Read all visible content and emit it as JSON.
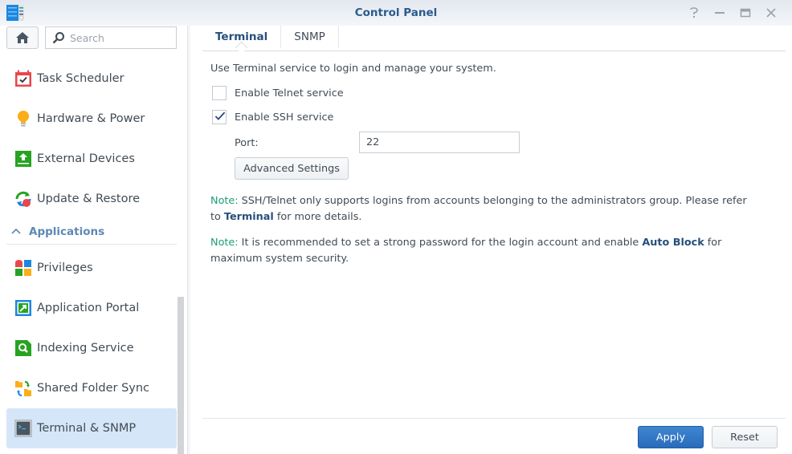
{
  "window": {
    "title": "Control Panel",
    "controls": [
      {
        "name": "help-icon",
        "glyph": "?"
      },
      {
        "name": "minimize-icon",
        "glyph": "—"
      },
      {
        "name": "maximize-icon",
        "glyph": "▭"
      },
      {
        "name": "close-icon",
        "glyph": "✕"
      }
    ]
  },
  "sidebar": {
    "search_placeholder": "Search",
    "items_top": [
      {
        "label": "Task Scheduler",
        "icon": "calendar-check-icon"
      },
      {
        "label": "Hardware & Power",
        "icon": "lightbulb-icon"
      },
      {
        "label": "External Devices",
        "icon": "upload-drive-icon"
      },
      {
        "label": "Update & Restore",
        "icon": "update-icon"
      }
    ],
    "section": {
      "label": "Applications",
      "expanded": true
    },
    "items_apps": [
      {
        "label": "Privileges",
        "icon": "privileges-icon"
      },
      {
        "label": "Application Portal",
        "icon": "portal-icon"
      },
      {
        "label": "Indexing Service",
        "icon": "indexing-icon"
      },
      {
        "label": "Shared Folder Sync",
        "icon": "folder-sync-icon"
      },
      {
        "label": "Terminal & SNMP",
        "icon": "terminal-icon",
        "selected": true
      }
    ]
  },
  "main": {
    "tabs": [
      {
        "label": "Terminal",
        "active": true
      },
      {
        "label": "SNMP",
        "active": false
      }
    ],
    "description": "Use Terminal service to login and manage your system.",
    "telnet": {
      "label": "Enable Telnet service",
      "checked": false
    },
    "ssh": {
      "label": "Enable SSH service",
      "checked": true
    },
    "port": {
      "label": "Port:",
      "value": "22"
    },
    "advanced_button": "Advanced Settings",
    "note1": {
      "label": "Note:",
      "text_before": " SSH/Telnet only supports logins from accounts belonging to the administrators group. Please refer to ",
      "link": "Terminal",
      "text_after": " for more details."
    },
    "note2": {
      "label": "Note:",
      "text_before": " It is recommended to set a strong password for the login account and enable ",
      "link": "Auto Block",
      "text_after": " for maximum system security."
    },
    "apply_button": "Apply",
    "reset_button": "Reset"
  },
  "colors": {
    "accent": "#2a6cba",
    "title": "#2a5a8e",
    "note_label": "#1d9d78",
    "selected_bg": "#d5e6f8"
  }
}
